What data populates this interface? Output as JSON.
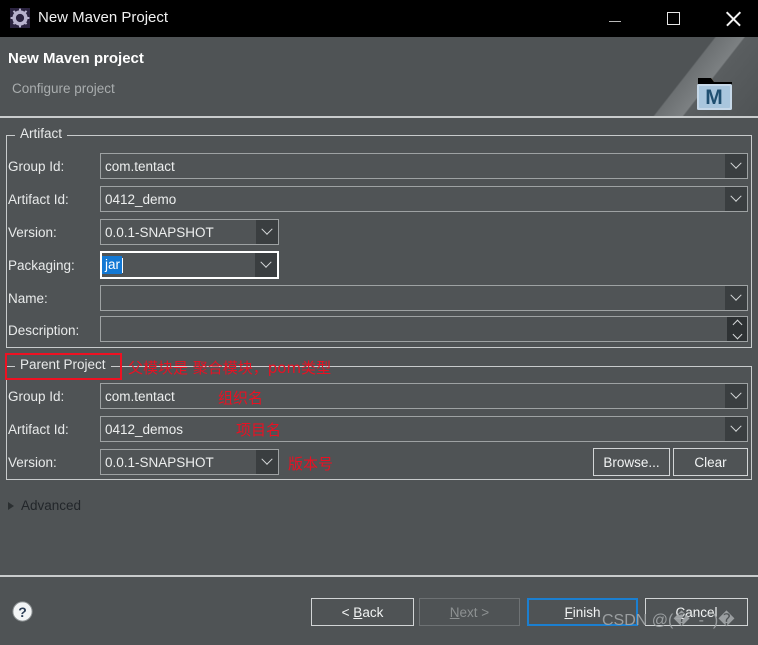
{
  "window": {
    "title": "New Maven Project",
    "icon": "maven-gear-icon",
    "minimize_label": "Minimize",
    "maximize_label": "Maximize",
    "close_label": "Close",
    "titlebar_color": "#000000",
    "body_color": "#4f5355"
  },
  "header": {
    "title": "New Maven project",
    "subtitle": "Configure project",
    "banner_icon": "maven-folder-m-icon"
  },
  "artifact": {
    "legend": "Artifact",
    "fields": [
      {
        "label": "Group Id:",
        "value": "com.tentact",
        "control": "combo"
      },
      {
        "label": "Artifact Id:",
        "value": "0412_demo",
        "control": "combo"
      },
      {
        "label": "Version:",
        "value": "0.0.1-SNAPSHOT",
        "control": "combo-short"
      },
      {
        "label": "Packaging:",
        "value": "jar",
        "control": "combo-short",
        "focused": true,
        "selected": true
      },
      {
        "label": "Name:",
        "value": "",
        "control": "combo"
      },
      {
        "label": "Description:",
        "value": "",
        "control": "spinner"
      }
    ]
  },
  "parent_project": {
    "legend": "Parent Project",
    "fields": [
      {
        "label": "Group Id:",
        "value": "com.tentact",
        "control": "combo"
      },
      {
        "label": "Artifact Id:",
        "value": "0412_demos",
        "control": "combo"
      },
      {
        "label": "Version:",
        "value": "0.0.1-SNAPSHOT",
        "control": "combo-short"
      }
    ],
    "browse_label": "Browse...",
    "clear_label": "Clear"
  },
  "advanced": {
    "label": "Advanced",
    "expanded": false
  },
  "buttons": {
    "back": {
      "label": "< Back",
      "mnemonic": "B",
      "enabled": true,
      "focused": false
    },
    "next": {
      "label": "Next >",
      "mnemonic": "N",
      "enabled": false,
      "focused": false
    },
    "finish": {
      "label": "Finish",
      "mnemonic": "F",
      "enabled": true,
      "focused": true
    },
    "cancel": {
      "label": "Cancel",
      "mnemonic": "C",
      "enabled": true,
      "focused": false
    },
    "help_icon": "help-question-icon"
  },
  "annotations": {
    "color": "#e81123",
    "parent_note": "父模块是 聚合模块，pom类型",
    "group_note": "组织名",
    "artifact_note": "项目名",
    "version_note": "版本号",
    "highlight_target": "Parent Project"
  },
  "watermark": {
    "text": "CSDN @(� ̄ - ̄ )�"
  }
}
